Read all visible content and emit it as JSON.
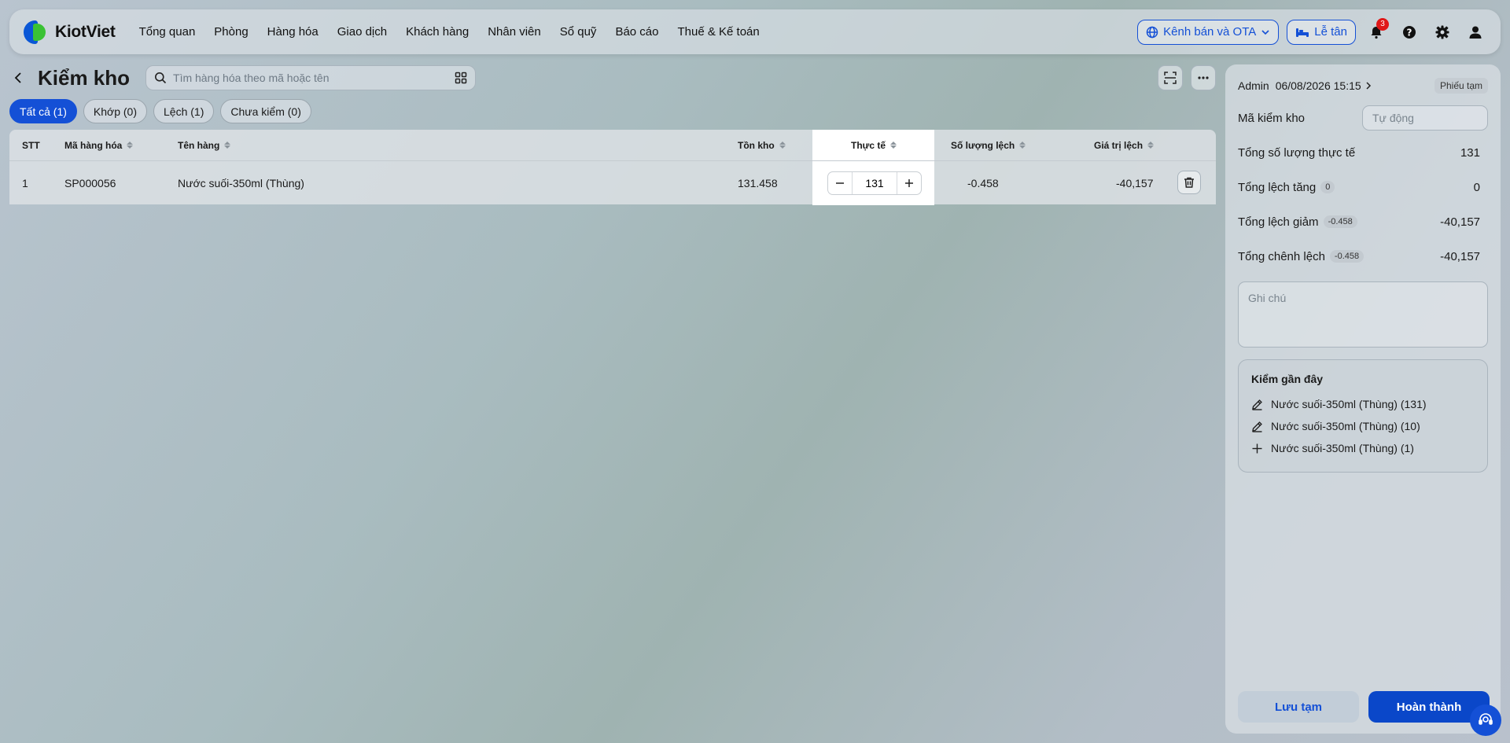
{
  "brand": {
    "name": "KiotViet"
  },
  "nav": {
    "items": [
      "Tổng quan",
      "Phòng",
      "Hàng hóa",
      "Giao dịch",
      "Khách hàng",
      "Nhân viên",
      "Sổ quỹ",
      "Báo cáo",
      "Thuế & Kế toán"
    ],
    "channel_label": "Kênh bán và OTA",
    "reception_label": "Lễ tân",
    "notification_count": "3"
  },
  "page": {
    "title": "Kiểm kho",
    "search_placeholder": "Tìm hàng hóa theo mã hoặc tên"
  },
  "filters": [
    {
      "label": "Tất cả (1)",
      "active": true
    },
    {
      "label": "Khớp (0)",
      "active": false
    },
    {
      "label": "Lệch (1)",
      "active": false
    },
    {
      "label": "Chưa kiểm (0)",
      "active": false
    }
  ],
  "table": {
    "headers": {
      "stt": "STT",
      "code": "Mã hàng hóa",
      "name": "Tên hàng",
      "stock": "Tồn kho",
      "actual": "Thực tế",
      "diff_qty": "Số lượng lệch",
      "diff_value": "Giá trị lệch"
    },
    "rows": [
      {
        "stt": "1",
        "code": "SP000056",
        "name": "Nước suối-350ml (Thùng)",
        "stock": "131.458",
        "actual": "131",
        "diff_qty": "-0.458",
        "diff_value": "-40,157"
      }
    ]
  },
  "side": {
    "user": "Admin",
    "datetime": "06/08/2026 15:15",
    "status_tag": "Phiếu tạm",
    "code_label": "Mã kiểm kho",
    "code_placeholder": "Tự động",
    "total_actual_label": "Tổng số lượng thực tế",
    "total_actual_value": "131",
    "increase_label": "Tổng lệch tăng",
    "increase_badge": "0",
    "increase_value": "0",
    "decrease_label": "Tổng lệch giảm",
    "decrease_badge": "-0.458",
    "decrease_value": "-40,157",
    "total_diff_label": "Tổng chênh lệch",
    "total_diff_badge": "-0.458",
    "total_diff_value": "-40,157",
    "note_placeholder": "Ghi chú",
    "recent_title": "Kiểm gần đây",
    "recent_items": [
      {
        "icon": "pencil-icon",
        "text": "Nước suối-350ml (Thùng) (131)"
      },
      {
        "icon": "pencil-icon",
        "text": "Nước suối-350ml (Thùng) (10)"
      },
      {
        "icon": "plus-icon",
        "text": "Nước suối-350ml (Thùng) (1)"
      }
    ],
    "save_label": "Lưu tạm",
    "done_label": "Hoàn thành"
  },
  "colors": {
    "primary": "#1450d6",
    "done": "#0a47c9",
    "badge": "#e01818"
  }
}
